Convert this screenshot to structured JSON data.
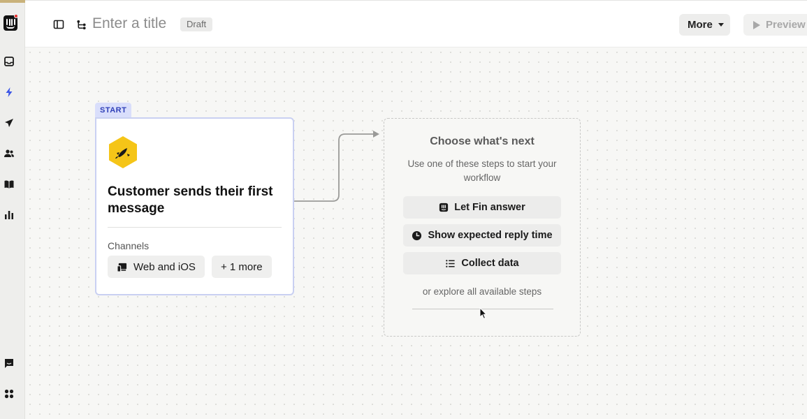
{
  "header": {
    "title_placeholder": "Enter a title",
    "status_badge": "Draft",
    "more_label": "More",
    "preview_label": "Preview"
  },
  "sidebar": {
    "items": [
      {
        "icon": "inbox-icon"
      },
      {
        "icon": "lightning-icon",
        "active": true
      },
      {
        "icon": "send-icon"
      },
      {
        "icon": "contacts-icon"
      },
      {
        "icon": "book-icon"
      },
      {
        "icon": "reports-icon"
      }
    ],
    "bottom_items": [
      {
        "icon": "messenger-icon"
      },
      {
        "icon": "apps-icon"
      }
    ]
  },
  "start_node": {
    "tag": "START",
    "icon": "rocket-icon",
    "title": "Customer sends their first message",
    "channels_label": "Channels",
    "channels": [
      {
        "label": "Web and iOS",
        "icon": "devices-icon"
      },
      {
        "label": "+ 1 more"
      }
    ]
  },
  "next_panel": {
    "title": "Choose what's next",
    "subtitle": "Use one of these steps to start your workflow",
    "steps": [
      {
        "label": "Let Fin answer",
        "icon": "fin-icon"
      },
      {
        "label": "Show expected reply time",
        "icon": "clock-icon"
      },
      {
        "label": "Collect data",
        "icon": "list-icon"
      }
    ],
    "explore_link": "or explore all available steps"
  },
  "colors": {
    "accent": "#3040b8",
    "start_tag_bg": "#d9defb",
    "hex_yellow": "#f5c518",
    "notification": "#e5312f"
  }
}
